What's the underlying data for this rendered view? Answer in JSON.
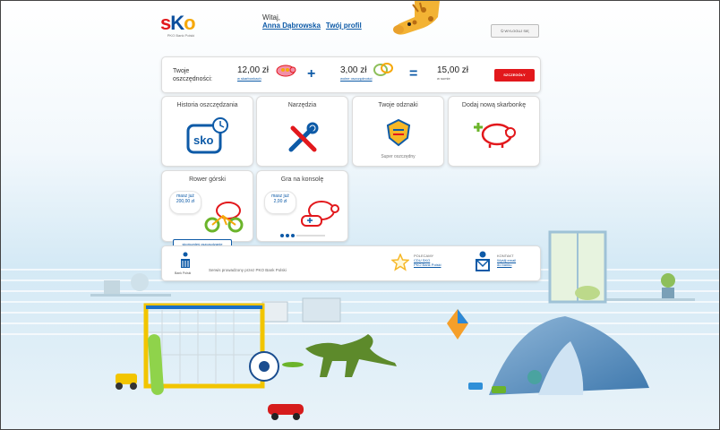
{
  "header": {
    "logo_text": "SKO",
    "logo_subtitle": "PKO Bank Polski",
    "greeting": "Witaj,",
    "user_name": "Anna Dąbrowska",
    "profile_link": "Twój profil",
    "logout_label": "WYLOGUJ SIĘ"
  },
  "savings": {
    "label_line1": "Twoje",
    "label_line2": "oszczędności:",
    "piggy_amount": "12,00 zł",
    "piggy_caption": "w skarbonkach",
    "plus": "+",
    "free_amount": "3,00 zł",
    "free_caption": "wolne oszczędności",
    "equals": "=",
    "total_amount": "15,00 zł",
    "total_caption": "w sumie",
    "details_button": "SZCZEGÓŁY"
  },
  "tiles": [
    {
      "title": "Historia oszczędzania",
      "icon": "sko-clock-icon"
    },
    {
      "title": "Narzędzia",
      "icon": "tools-icon"
    },
    {
      "title": "Twoje odznaki",
      "icon": "badge-icon",
      "caption": "Super oszczędny"
    },
    {
      "title": "Dodaj nową skarbonkę",
      "icon": "add-piggy-icon"
    }
  ],
  "goals": [
    {
      "title": "Rower górski",
      "bubble_line1": "masz już",
      "bubble_line2": "200,00 zł",
      "button": "skończyłeś oszczędzanie",
      "icon": "bike-piggy-icon"
    },
    {
      "title": "Gra na konsolę",
      "bubble_line1": "masz już",
      "bubble_line2": "2,00 zł",
      "icon": "gamepad-piggy-icon",
      "progress": 0.08
    }
  ],
  "footer": {
    "bank_label": "Bank Polski",
    "general_text": "Serwis prowadzony przez PKO Bank Polski",
    "recommended_title": "POLECAMY",
    "recommended_link1": "CDU SKO",
    "recommended_link2": "PKO Bank Polski",
    "contact_title": "KONTAKT",
    "contact_link1": "Wyślij email",
    "contact_link2": "do banku"
  },
  "colors": {
    "accent_red": "#e2181c",
    "brand_blue": "#0d5aa7",
    "wall_blue": "#d6ebf6"
  }
}
